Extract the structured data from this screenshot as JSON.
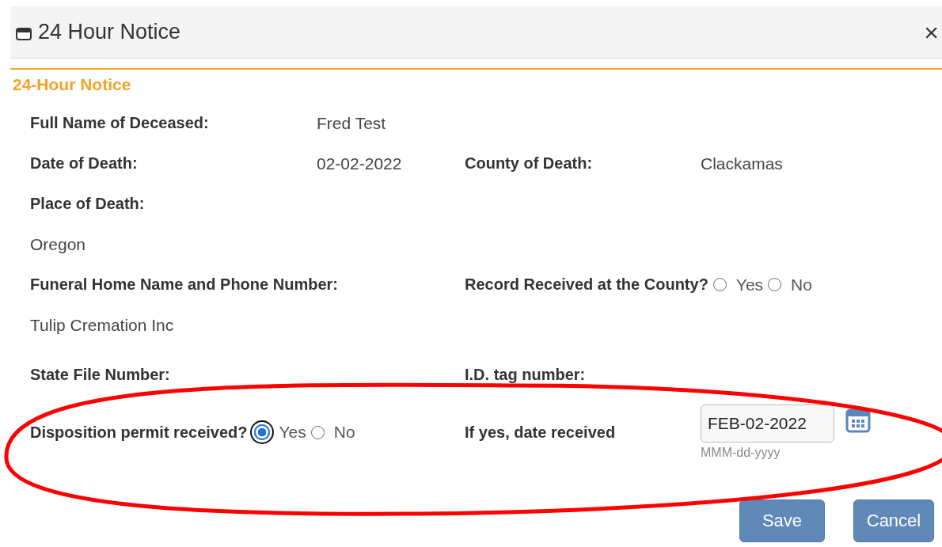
{
  "dialog": {
    "title": "24 Hour Notice",
    "close": "×"
  },
  "section": {
    "heading": "24-Hour Notice"
  },
  "rows": [
    {
      "left": {
        "kind": "pair",
        "label": "Full Name of Deceased:",
        "value": "Fred Test"
      }
    },
    {
      "left": {
        "kind": "pair",
        "label": "Date of Death:",
        "value": "02-02-2022"
      },
      "right": {
        "kind": "pair",
        "label": "County of Death:",
        "value": "Clackamas"
      }
    },
    {
      "left": {
        "kind": "label",
        "label": "Place of Death:"
      }
    },
    {
      "left": {
        "kind": "value",
        "value": "Oregon"
      }
    },
    {
      "left": {
        "kind": "label",
        "label": "Funeral Home Name and Phone Number:"
      },
      "right": {
        "kind": "radio",
        "label": "Record Received at the County?",
        "options": [
          {
            "label": "Yes",
            "selected": false
          },
          {
            "label": "No",
            "selected": false
          }
        ]
      }
    },
    {
      "left": {
        "kind": "value",
        "value": "Tulip Cremation Inc"
      }
    },
    {
      "left": {
        "kind": "label",
        "label": "State File Number:"
      },
      "right": {
        "kind": "label",
        "label": "I.D. tag number:"
      }
    },
    {
      "left": {
        "kind": "radio",
        "label": "Disposition permit received?",
        "options": [
          {
            "label": "Yes",
            "selected": true
          },
          {
            "label": "No",
            "selected": false
          }
        ]
      },
      "right": {
        "kind": "date",
        "label": "If yes, date received",
        "value": "FEB-02-2022",
        "hint": "MMM-dd-yyyy"
      }
    }
  ],
  "buttons": [
    "Save",
    "Cancel"
  ],
  "annotations": [
    {
      "kind": "ellipse"
    }
  ]
}
